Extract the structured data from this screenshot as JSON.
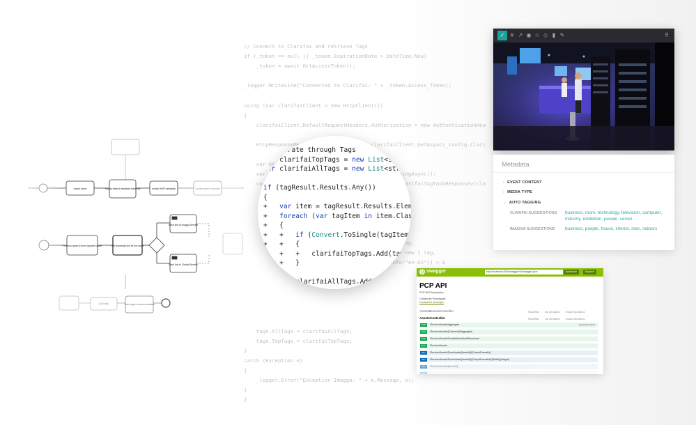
{
  "code_lines": [
    "// Connect to Clarifai and retrieve Tags",
    "if (_token == null || _token.ExpirationDate > DateTime.Now)",
    "    _token = await GetAccessToken();",
    "",
    "_logger.WriteLine(\"Connected to Clarifai: \" + _token.Access_Token);",
    "",
    "using (var clarifaiClient = new HttpClient())",
    "{",
    "    clarifaiClient.DefaultRequestHeaders.Authorization = new AuthenticationHea",
    "",
    "    HttpResponseMessage response = await clarifaiClient.GetAsync(_config.Clari",
    "",
    "    var httpContent = response.Content;",
    "    var stringContent = await httpContent.ReadAsStringAsync();",
    "    var tagResult = JsonConvert.DeserializeObject<ClarifaiTagTaskResponse>(cla",
    "",
    "",
    "",
    "",
    "",
    "                                           .Result.Tag;",
    "                                    (tag, index) => new { tag,",
    "                                    new CultureInfo(\"en-US\")) > 0",
    "",
    "",
    "",
    "                                    ",
    "",
    "",
    "    tags.AllTags = clarifaiAllTags;",
    "    tags.TopTags = clarifaiTopTags;",
    "}",
    "catch (Exception e)",
    "{",
    "    _logger.Error(\"Exception Imagga: \" + e.Message, e);",
    "}",
    "}"
  ],
  "lens_lines": [
    "// Iterate through Tags",
    "var clarifaiTopTags = new List<string",
    "var clarifaiAllTags = new List<string>()",
    "",
    "if (tagResult.Results.Any())",
    "{",
    "+   var item = tagResult.Results.ElementAt",
    "+   foreach (var tagItem in item.Classes.Select((tag, index) => new",
    "+   {",
    "+   +   if (Convert.ToSingle(tagItem.prob",
    "+   +   {",
    "+   +   +   clarifaiTopTags.Add(tagItem",
    "+   +   }",
    "",
    "        clarifaiAllTags.Add(tagIt"
  ],
  "flow": {
    "top_row": [
      "Import asset",
      "Assign default metadata schemas",
      "extract XMP metadata",
      "Update asset metadata"
    ],
    "middle": [
      "Previous asset id from imported asset",
      "Get thumbnail link for the asset"
    ],
    "services": [
      "Send link to Imagga Service",
      "Send link to Clarifai Service"
    ],
    "bottom_row": [
      "",
      "Split tags",
      "Save tags to asset metadata"
    ]
  },
  "photo_toolbar": [
    "check-icon",
    "hash-icon",
    "share-icon",
    "eye-icon",
    "star-icon",
    "tag-icon",
    "trash-icon",
    "pen-icon"
  ],
  "metadata": {
    "title": "Metadata",
    "sections": [
      "EVENT CONTENT",
      "MEDIA TYPE",
      "AUTO TAGGING"
    ],
    "rows": [
      {
        "label": "CLARIFAI SUGGESTIONS",
        "value": "business, room, technology, television, computer, industry, exhibition, people, server"
      },
      {
        "label": "IMAGGA SUGGESTIONS",
        "value": "business, people, house, interior, man, indoors"
      }
    ]
  },
  "swagger": {
    "logo": "swagger",
    "url": "http://localhost:4000/swagger/v1/swagger.json",
    "authorize": "Authorize",
    "explore": "Explore",
    "title": "PCP API",
    "description": "PCP API Description",
    "created_by": "Created by Picturegeek",
    "contact": "Contact the developer",
    "group1": "AssetsBrowseController",
    "group2": "AssetsController",
    "links": [
      "Show/Hide",
      "List Operations",
      "Expand Operations"
    ],
    "endpoints": [
      {
        "method": "POST",
        "path": "/Service/Assets/Aggregate",
        "note": "Aggregated fields"
      },
      {
        "method": "POST",
        "path": "/Service/Assets/{CustomId}/Aggregate",
        "note": ""
      },
      {
        "method": "POST",
        "path": "/Service/Assets/CreateBatchAssetDownload",
        "note": ""
      },
      {
        "method": "POST",
        "path": "/Service/Assets",
        "note": ""
      },
      {
        "method": "GET",
        "path": "/Service/Assets/Downloads/{AssetId}/{OutputFormatId}",
        "note": ""
      },
      {
        "method": "GET",
        "path": "/Service/Assets/Downloads/{AssetId}/{OutputFormatId}/{Width}/{Height}",
        "note": ""
      },
      {
        "method": "GET",
        "path": "/Service/Assets/{AssetId}",
        "note": ""
      },
      {
        "method": "GET",
        "path": "",
        "note": ""
      }
    ]
  },
  "colors": {
    "accent": "#1aa39b",
    "swagger_green": "#89bf04",
    "swagger_dark": "#547f00",
    "post": "#10a54a",
    "get": "#0f6ab4"
  }
}
